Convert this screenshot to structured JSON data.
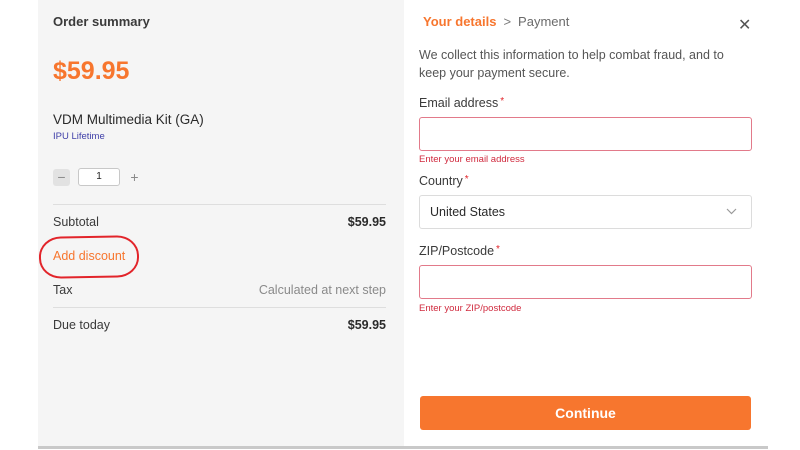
{
  "summary": {
    "title": "Order summary",
    "price": "$59.95",
    "product_name": "VDM Multimedia Kit (GA)",
    "product_sub": "IPU Lifetime",
    "quantity": "1",
    "minus": "−",
    "plus": "+",
    "subtotal_label": "Subtotal",
    "subtotal_value": "$59.95",
    "discount_label": "Add discount",
    "tax_label": "Tax",
    "tax_value": "Calculated at next step",
    "due_label": "Due today",
    "due_value": "$59.95"
  },
  "details": {
    "step_active": "Your details",
    "step_separator": ">",
    "step_next": "Payment",
    "close": "✕",
    "intro": "We collect this information to help combat fraud, and to keep your payment secure.",
    "email_label": "Email address",
    "email_value": "",
    "email_error": "Enter your email address",
    "country_label": "Country",
    "country_value": "United States",
    "zip_label": "ZIP/Postcode",
    "zip_value": "",
    "zip_error": "Enter your ZIP/postcode",
    "required_mark": "*",
    "continue_label": "Continue"
  },
  "colors": {
    "accent": "#f7762e",
    "error": "#d02a3e",
    "annotation": "#e2242a"
  }
}
